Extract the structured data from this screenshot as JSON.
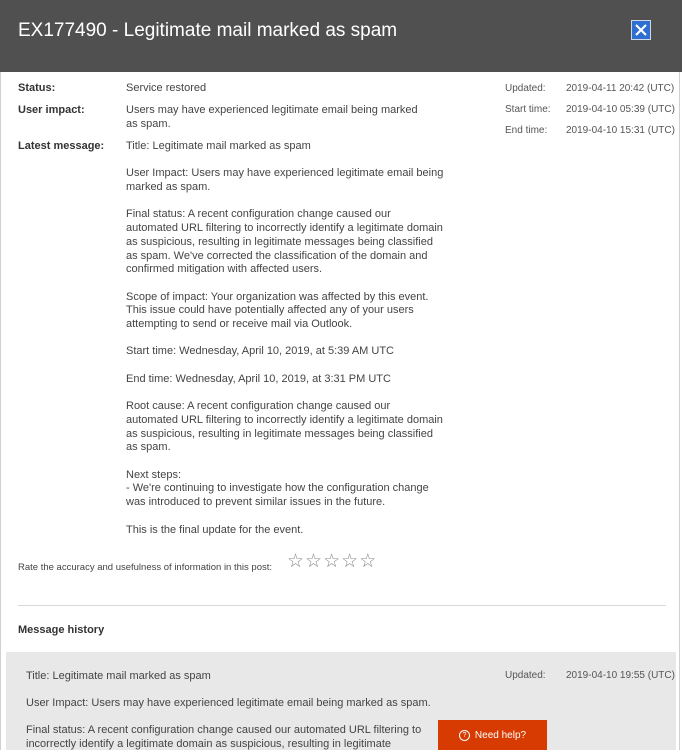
{
  "header": {
    "title": "EX177490 - Legitimate mail marked as spam",
    "close_icon": "close-icon"
  },
  "details": {
    "status_label": "Status:",
    "status_value": "Service restored",
    "impact_label": "User impact:",
    "impact_value": "Users may have experienced legitimate email being marked as spam.",
    "latest_label": "Latest message:",
    "latest_message": [
      "Title: Legitimate mail marked as spam",
      "User Impact: Users may have experienced legitimate email being marked as spam.",
      "Final status: A recent configuration change caused our automated URL filtering to incorrectly identify a legitimate domain as suspicious, resulting in legitimate messages being classified as spam. We've corrected the classification of the domain and confirmed mitigation with affected users.",
      "Scope of impact: Your organization was affected by this event. This issue could have potentially affected any of your users attempting to send or receive mail via Outlook.",
      "Start time: Wednesday, April 10, 2019, at 5:39 AM UTC",
      "End time: Wednesday, April 10, 2019, at 3:31 PM UTC",
      "Root cause: A recent configuration change caused our automated URL filtering to incorrectly identify a legitimate domain as suspicious, resulting in legitimate messages being classified as spam.",
      "Next steps:\n- We're continuing to investigate how the configuration change was introduced to prevent similar issues in the future.",
      "This is the final update for the event."
    ]
  },
  "meta": {
    "updated_label": "Updated:",
    "updated_value": "2019-04-11 20:42 (UTC)",
    "start_label": "Start time:",
    "start_value": "2019-04-10 05:39 (UTC)",
    "end_label": "End time:",
    "end_value": "2019-04-10 15:31 (UTC)"
  },
  "rating": {
    "prompt": "Rate the accuracy and usefulness of information in this post:",
    "star_glyph": "☆"
  },
  "history": {
    "title": "Message history",
    "entry_title": "Title: Legitimate mail marked as spam",
    "entry_impact": "User Impact: Users may have experienced legitimate email being marked as spam.",
    "entry_status_line1": "Final status: A recent configuration change caused our automated URL filtering to",
    "entry_status_line2": "incorrectly identify a legitimate domain as suspicious, resulting in legitimate",
    "updated_label": "Updated:",
    "updated_value": "2019-04-10 19:55 (UTC)"
  },
  "help": {
    "label": "Need help?",
    "icon": "?"
  },
  "colors": {
    "header_bg": "#505050",
    "close_bg": "#2f6fcf",
    "help_bg": "#d83b01",
    "history_bg": "#e8e8e8"
  }
}
